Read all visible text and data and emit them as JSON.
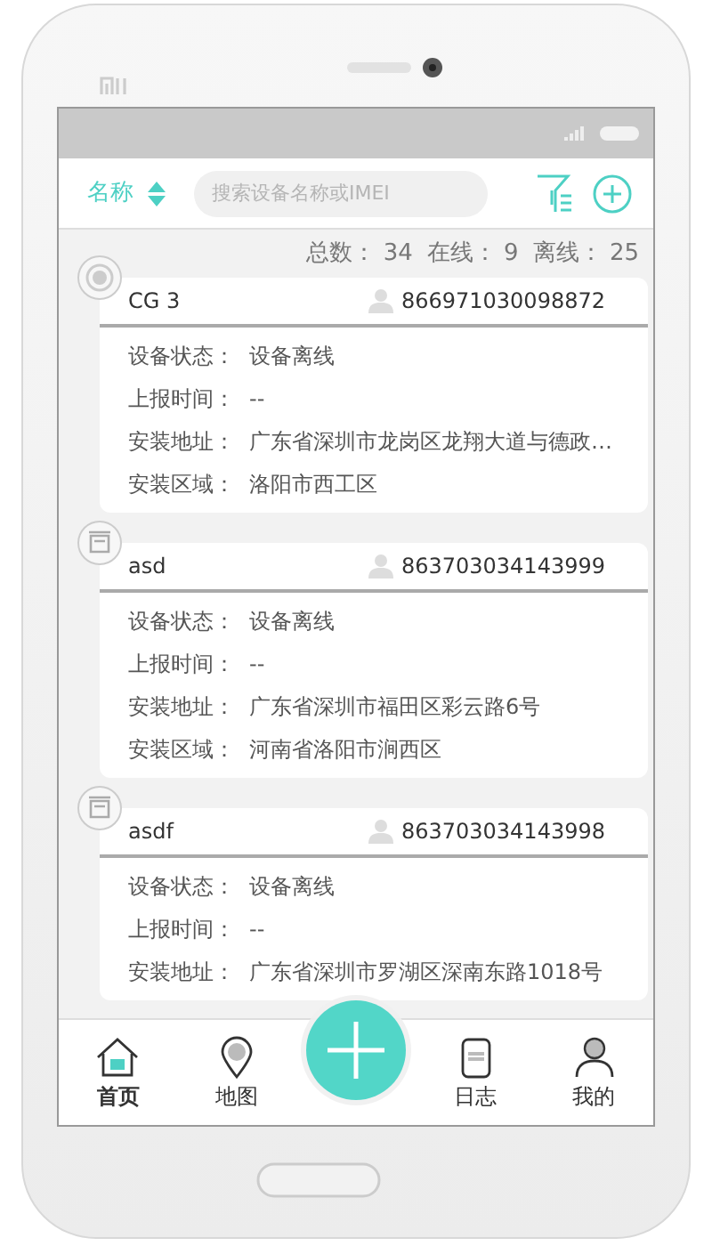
{
  "header": {
    "sort_label": "名称",
    "search": {
      "placeholder": "搜索设备名称或IMEI"
    }
  },
  "summary": [
    {
      "label": "总数：",
      "value": "34"
    },
    {
      "label": "在线：",
      "value": "9"
    },
    {
      "label": "离线：",
      "value": "25"
    }
  ],
  "devices": [
    {
      "kind": "target",
      "name": "CG 3",
      "imei": "866971030098872",
      "fields": [
        {
          "label": "设备状态：",
          "value": "设备离线"
        },
        {
          "label": "上报时间：",
          "value": "--"
        },
        {
          "label": "安装地址：",
          "value": "广东省深圳市龙岗区龙翔大道与德政…"
        },
        {
          "label": "安装区域：",
          "value": "洛阳市西工区"
        }
      ]
    },
    {
      "kind": "box",
      "name": "asd",
      "imei": "863703034143999",
      "fields": [
        {
          "label": "设备状态：",
          "value": "设备离线"
        },
        {
          "label": "上报时间：",
          "value": "--"
        },
        {
          "label": "安装地址：",
          "value": "广东省深圳市福田区彩云路6号"
        },
        {
          "label": "安装区域：",
          "value": "河南省洛阳市涧西区"
        }
      ]
    },
    {
      "kind": "box",
      "name": "asdf",
      "imei": "863703034143998",
      "fields": [
        {
          "label": "设备状态：",
          "value": "设备离线"
        },
        {
          "label": "上报时间：",
          "value": "--"
        },
        {
          "label": "安装地址：",
          "value": "广东省深圳市罗湖区深南东路1018号"
        }
      ]
    }
  ],
  "tabs": [
    {
      "label": "首页",
      "selected": true
    },
    {
      "label": "地图",
      "selected": false
    },
    {
      "label": "日志",
      "selected": false
    },
    {
      "label": "我的",
      "selected": false
    }
  ]
}
